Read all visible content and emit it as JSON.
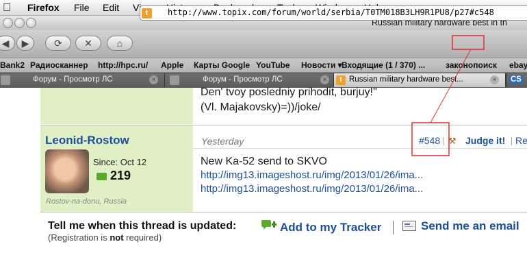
{
  "menubar": {
    "app": "Firefox",
    "items": [
      "File",
      "Edit",
      "View",
      "History",
      "Bookmarks",
      "Tools",
      "Window",
      "Help"
    ]
  },
  "window": {
    "title": "Russian military hardware best in th"
  },
  "navbar": {
    "url": "http://www.topix.com/forum/world/serbia/T0TM018B3LH9R1PU8/p27#c548",
    "favicon_letter": "t"
  },
  "bookmarks": [
    "Bank2",
    "Радиосканнер",
    "http://hpc.ru/",
    "Apple",
    "Карты Google",
    "YouTube",
    "Новости ▾",
    "Входящие (1 / 370) ...",
    "законопоиск",
    "ebay"
  ],
  "tabs": [
    {
      "label": "Форум - Просмотр ЛС",
      "active": false
    },
    {
      "label": "Форум - Просмотр ЛС",
      "active": false
    },
    {
      "label": "Russian military hardware best...",
      "active": true,
      "favicon_letter": "t"
    },
    {
      "label": "CS",
      "active": false
    }
  ],
  "post": {
    "quote_lines": [
      "Den' tvoy posledniy prihodit, burjuy!\"",
      "(Vl. Majakovsky)=))/joke/"
    ],
    "username": "Leonid-Rostow",
    "since": "Since: Oct 12",
    "post_count": "219",
    "location": "Rostov-na-donu, Russia",
    "time": "Yesterday",
    "post_number": "#548",
    "judge": "Judge it!",
    "reply": "Re",
    "text": "New Ka-52 send to SKVO",
    "links": [
      "http://img13.imageshost.ru/img/2013/01/26/ima...",
      "http://img13.imageshost.ru/img/2013/01/26/ima..."
    ]
  },
  "footer": {
    "tell_me": "Tell me when this thread is updated:",
    "reg_prefix": "(Registration is ",
    "reg_not": "not",
    "reg_suffix": " required)",
    "tracker": "Add to my Tracker",
    "email": "Send me an email"
  },
  "colors": {
    "link": "#1a4f99",
    "sidebar": "#e1efc7",
    "annotation": "#e03030",
    "tracker_icon": "#5aa82c"
  }
}
